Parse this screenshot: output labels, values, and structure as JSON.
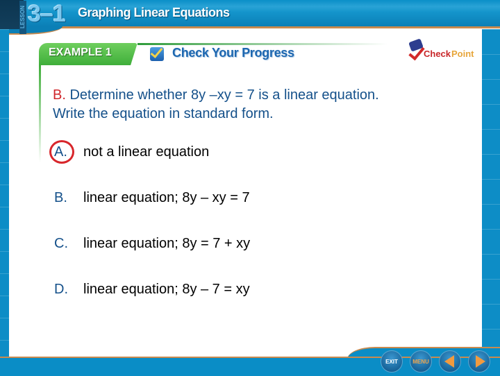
{
  "header": {
    "lesson_label": "LESSON",
    "lesson_number": "3–1",
    "lesson_title": "Graphing Linear Equations"
  },
  "example": {
    "tab_label": "EXAMPLE 1",
    "check_title": "Check Your Progress"
  },
  "logo": {
    "part1": "Check",
    "part2": "Point",
    "colors": {
      "check": "#c8272a",
      "point": "#e7a53a"
    }
  },
  "question": {
    "part_label": "B.",
    "line1": " Determine whether 8y –xy = 7 is a linear equation.",
    "line2": "Write the equation in standard form."
  },
  "options": [
    {
      "letter": "A.",
      "text": "not a linear equation",
      "selected": true
    },
    {
      "letter": "B.",
      "text": "linear equation; 8y – xy = 7",
      "selected": false
    },
    {
      "letter": "C.",
      "text": "linear equation; 8y = 7 + xy",
      "selected": false
    },
    {
      "letter": "D.",
      "text": "linear equation; 8y – 7 = xy",
      "selected": false
    }
  ],
  "nav": {
    "exit_label": "EXIT",
    "menu_label": "MENU",
    "prev_icon": "triangle-left",
    "next_icon": "triangle-right"
  },
  "colors": {
    "banner_blue": "#0d8dc6",
    "accent_orange": "#c98a4e",
    "tab_green": "#3fae3a",
    "question_blue": "#14508a",
    "part_red": "#d0262b",
    "selection_ring": "#d8262b"
  }
}
